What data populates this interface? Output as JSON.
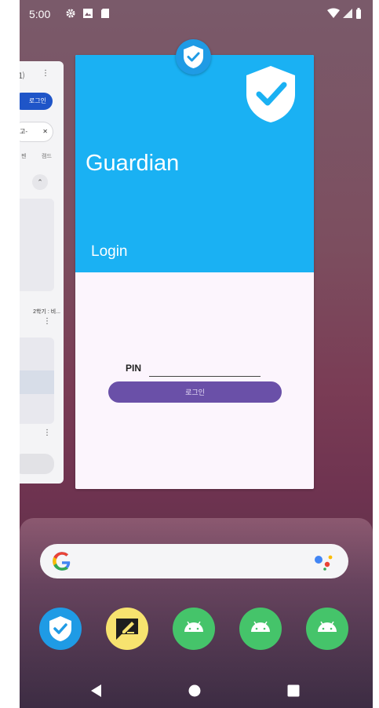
{
  "status_bar": {
    "time": "5:00",
    "icons": [
      "gear-icon",
      "photo-icon",
      "sd-card-icon"
    ],
    "right_icons": [
      "wifi-icon",
      "signal-icon",
      "battery-icon"
    ]
  },
  "previous_app": {
    "login_label": "로그인",
    "chip_label": "고-",
    "tabs": [
      "펜",
      "캠드"
    ],
    "caption": "2학기 : 비..."
  },
  "guardian_app": {
    "title": "Guardian",
    "subtitle": "Login",
    "pin_label": "PIN",
    "pin_value": "",
    "pin_placeholder": "",
    "login_button_label": "로그인",
    "accent_color": "#1ab1f3",
    "button_color": "#6a50a8"
  },
  "dock": {
    "apps": [
      "guardian-app-icon",
      "notes-app-icon",
      "android-app-icon",
      "android-app-icon",
      "android-app-icon"
    ]
  },
  "navigation": {
    "buttons": [
      "back-button",
      "home-button",
      "recents-button"
    ]
  }
}
